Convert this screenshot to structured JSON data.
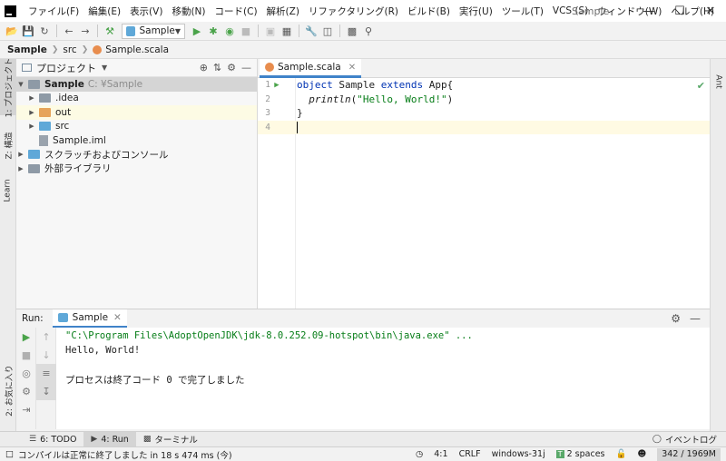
{
  "window": {
    "title": "Sample",
    "menu": [
      "ファイル(F)",
      "編集(E)",
      "表示(V)",
      "移動(N)",
      "コード(C)",
      "解析(Z)",
      "リファクタリング(R)",
      "ビルド(B)",
      "実行(U)",
      "ツール(T)",
      "VCS (S)",
      "ウィンドウ(W)",
      "ヘルプ(H)"
    ]
  },
  "toolbar": {
    "run_config": "Sample"
  },
  "breadcrumb": [
    "Sample",
    "src",
    "Sample.scala"
  ],
  "project_panel": {
    "title": "プロジェクト",
    "tree": {
      "root_name": "Sample",
      "root_path": "C:        ¥Sample",
      "items": [
        ".idea",
        "out",
        "src",
        "Sample.iml"
      ],
      "scratch": "スクラッチおよびコンソール",
      "libraries": "外部ライブラリ"
    }
  },
  "left_strip": {
    "project": "1: プロジェクト",
    "structure": "Z: 構造",
    "learn": "Learn",
    "favorites": "2: お気に入り"
  },
  "right_strip": {
    "ant": "Ant"
  },
  "editor": {
    "tab": "Sample.scala",
    "lines": [
      {
        "num": "1",
        "kw1": "object",
        "t1": " Sample ",
        "kw2": "extends",
        "t2": " App{"
      },
      {
        "num": "2",
        "fn": "println",
        "t1": "(",
        "str": "\"Hello, World!\"",
        "t2": ")"
      },
      {
        "num": "3",
        "t1": "}"
      },
      {
        "num": "4"
      }
    ]
  },
  "run": {
    "label": "Run:",
    "tab": "Sample",
    "console": [
      "\"C:\\Program Files\\AdoptOpenJDK\\jdk-8.0.252.09-hotspot\\bin\\java.exe\" ...",
      "Hello, World!",
      "",
      "プロセスは終了コード 0 で完了しました"
    ]
  },
  "bottom_tabs": {
    "todo": "6: TODO",
    "run": "4: Run",
    "terminal": "ターミナル",
    "event_log": "イベントログ"
  },
  "status": {
    "message": "コンパイルは正常に終了しました in 18 s 474 ms (今)",
    "position": "4:1",
    "line_sep": "CRLF",
    "encoding": "windows-31j",
    "indent": "2 spaces",
    "memory": "342 / 1969M"
  }
}
